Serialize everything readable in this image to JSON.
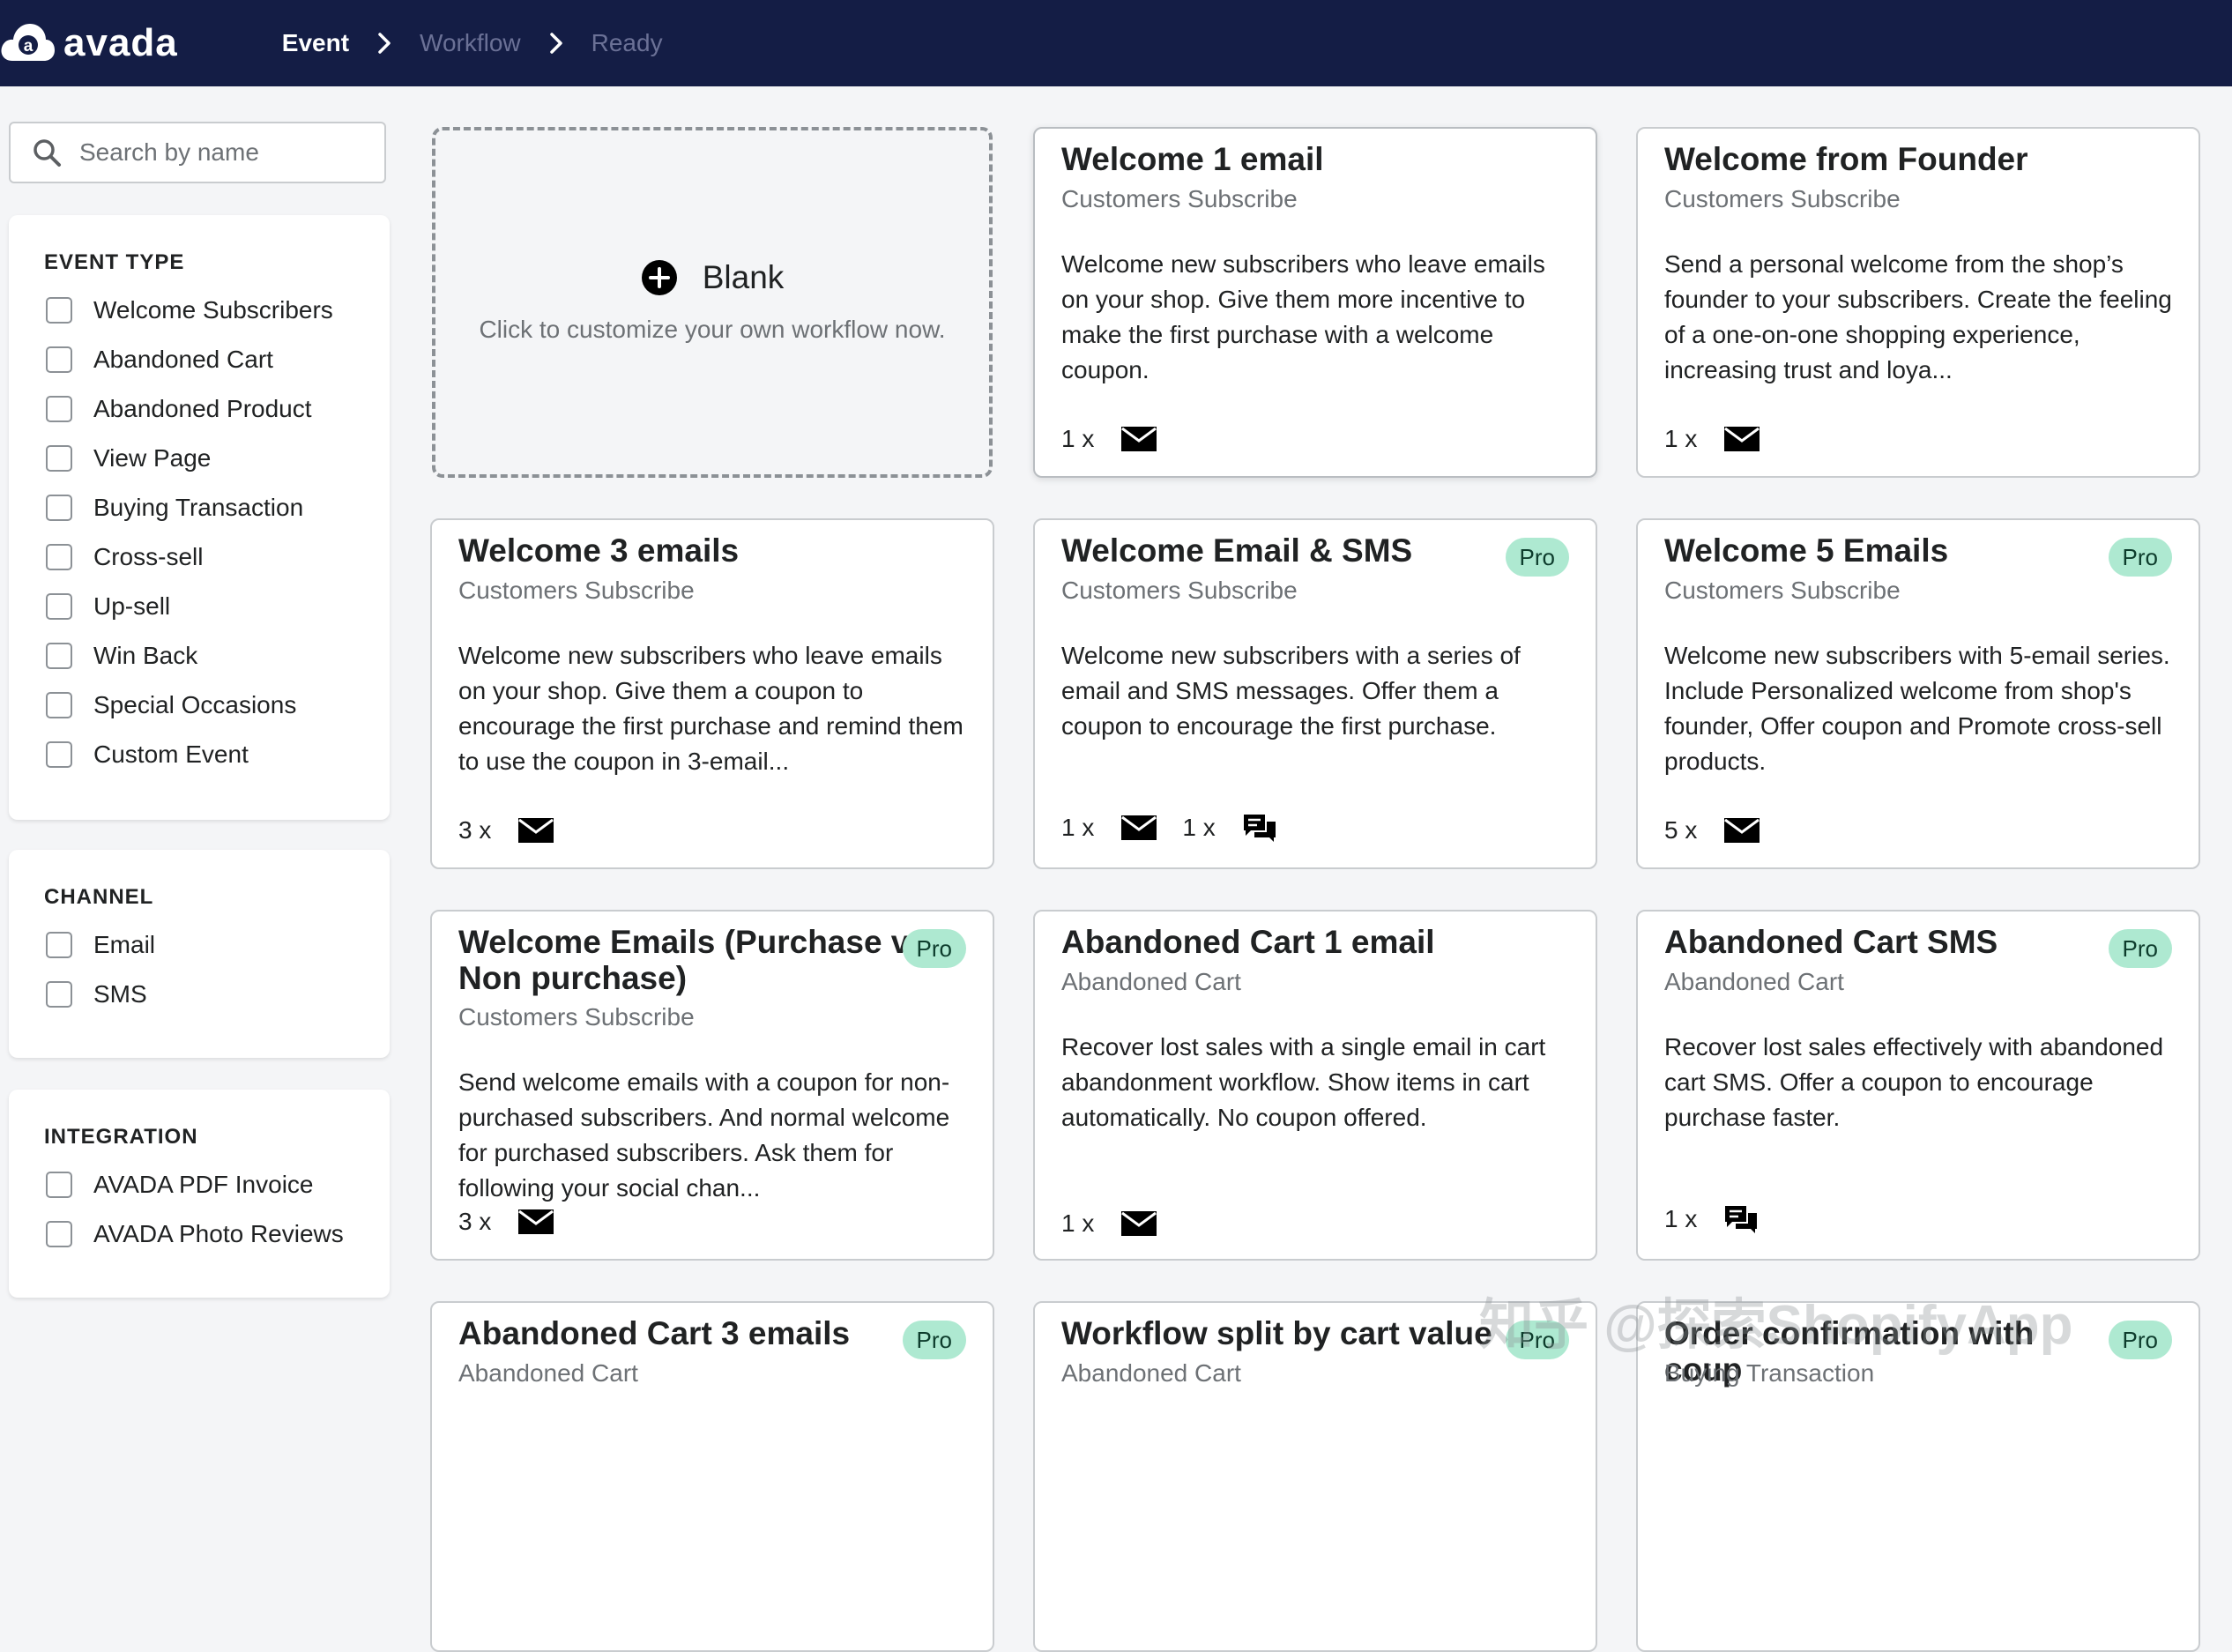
{
  "app": {
    "logo_text": "avada",
    "logo_letter": "a"
  },
  "breadcrumb": [
    {
      "label": "Event",
      "active": true
    },
    {
      "label": "Workflow",
      "active": false
    },
    {
      "label": "Ready",
      "active": false
    }
  ],
  "search": {
    "placeholder": "Search by name",
    "value": ""
  },
  "filters": {
    "event_type": {
      "title": "EVENT TYPE",
      "items": [
        "Welcome Subscribers",
        "Abandoned Cart",
        "Abandoned Product",
        "View Page",
        "Buying Transaction",
        "Cross-sell",
        "Up-sell",
        "Win Back",
        "Special Occasions",
        "Custom Event"
      ]
    },
    "channel": {
      "title": "CHANNEL",
      "items": [
        "Email",
        "SMS"
      ]
    },
    "integration": {
      "title": "INTEGRATION",
      "items": [
        "AVADA PDF Invoice",
        "AVADA Photo Reviews"
      ]
    }
  },
  "blank": {
    "title": "Blank",
    "subtitle": "Click to customize your own workflow now."
  },
  "cards": [
    {
      "title": "Welcome 1 email",
      "category": "Customers Subscribe",
      "description": "Welcome new subscribers who leave emails on your shop. Give them more incentive to make the first purchase with a welcome coupon.",
      "pro": "",
      "counts": [
        "1 x"
      ],
      "icons": [
        "email-icon"
      ]
    },
    {
      "title": "Welcome from Founder",
      "category": "Customers Subscribe",
      "description": "Send a personal welcome from the shop’s founder to your subscribers. Create the feeling of a one-on-one shopping experience, increasing trust and loya...",
      "pro": "",
      "counts": [
        "1 x"
      ],
      "icons": [
        "email-icon"
      ]
    },
    {
      "title": "Welcome 3 emails",
      "category": "Customers Subscribe",
      "description": "Welcome new subscribers who leave emails on your shop. Give them a coupon to encourage the first purchase and remind them to use the coupon in 3-email...",
      "pro": "",
      "counts": [
        "3 x"
      ],
      "icons": [
        "email-icon"
      ]
    },
    {
      "title": "Welcome Email & SMS",
      "category": "Customers Subscribe",
      "description": "Welcome new subscribers with a series of email and SMS messages. Offer them a coupon to encourage the first purchase.",
      "pro": "Pro",
      "counts": [
        "1 x",
        "1 x"
      ],
      "icons": [
        "email-icon",
        "sms-icon"
      ]
    },
    {
      "title": "Welcome 5 Emails",
      "category": "Customers Subscribe",
      "description": "Welcome new subscribers with 5-email series. Include Personalized welcome from shop's founder, Offer coupon and Promote cross-sell products.",
      "pro": "Pro",
      "counts": [
        "5 x"
      ],
      "icons": [
        "email-icon"
      ]
    },
    {
      "title": "Welcome Emails (Purchase vs Non purchase)",
      "category": "Customers Subscribe",
      "description": "Send welcome emails with a coupon for non-purchased subscribers. And normal welcome for purchased subscribers. Ask them for following your social chan...",
      "pro": "Pro",
      "counts": [
        "3 x"
      ],
      "icons": [
        "email-icon"
      ]
    },
    {
      "title": "Abandoned Cart 1 email",
      "category": "Abandoned Cart",
      "description": "Recover lost sales with a single email in cart abandonment workflow. Show items in cart automatically. No coupon offered.",
      "pro": "",
      "counts": [
        "1 x"
      ],
      "icons": [
        "email-icon"
      ]
    },
    {
      "title": "Abandoned Cart SMS",
      "category": "Abandoned Cart",
      "description": "Recover lost sales effectively with abandoned cart SMS. Offer a coupon to encourage purchase faster.",
      "pro": "Pro",
      "counts": [
        "1 x"
      ],
      "icons": [
        "sms-icon"
      ]
    },
    {
      "title": "Abandoned Cart 3 emails",
      "category": "Abandoned Cart",
      "pro": "Pro"
    },
    {
      "title": "Workflow split by cart value",
      "category": "Abandoned Cart",
      "pro": "Pro"
    },
    {
      "title": "Order confirmation with coup",
      "category": "Buying Transaction",
      "pro": "Pro"
    }
  ],
  "watermark": "知乎 @探索ShopifyApp"
}
